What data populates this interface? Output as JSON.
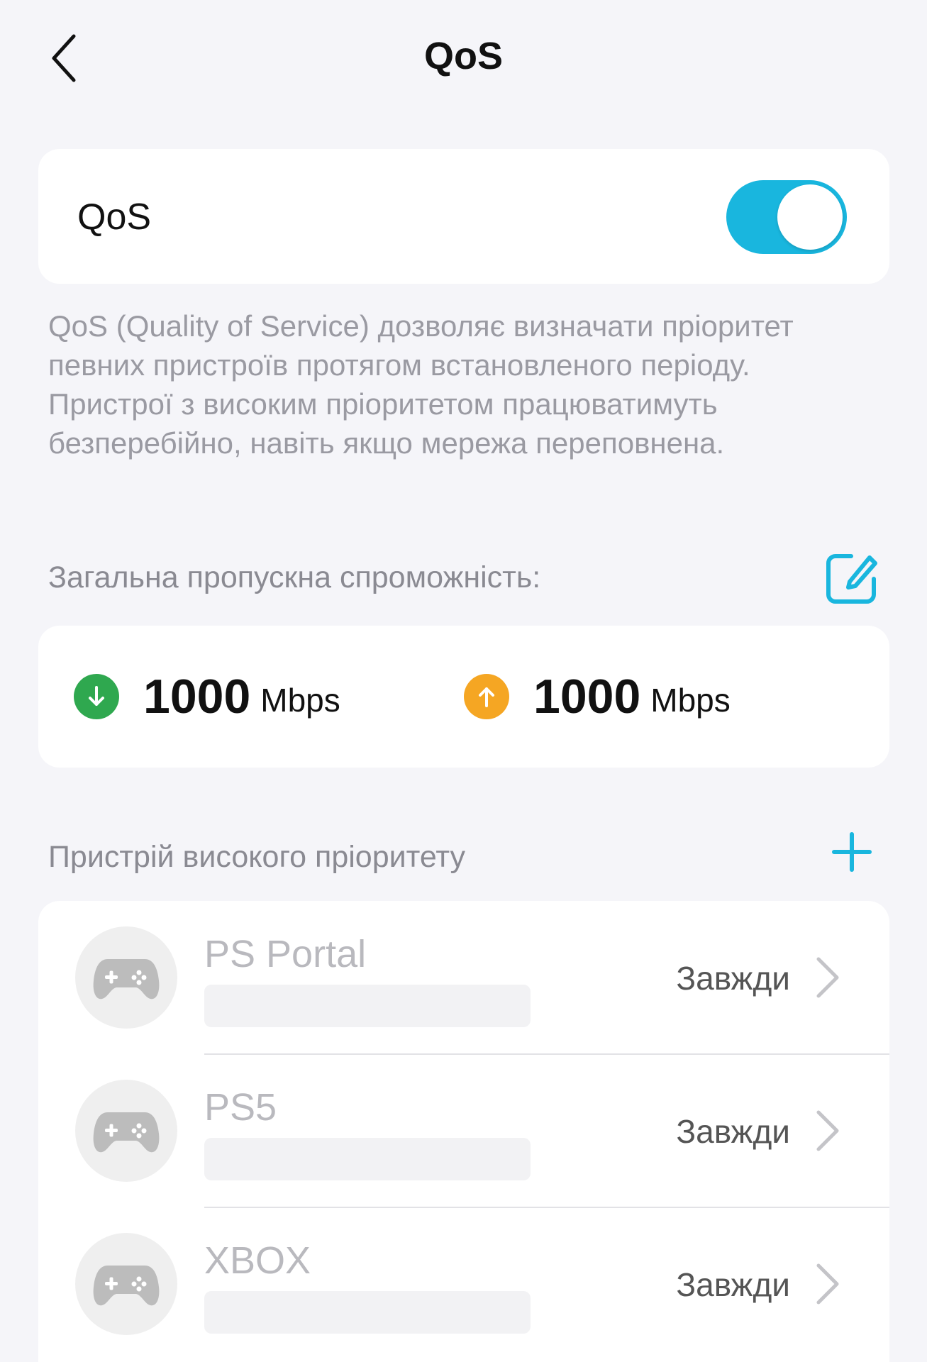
{
  "nav": {
    "title": "QoS",
    "back_icon": "chevron-left-icon"
  },
  "qos_toggle": {
    "label": "QoS",
    "enabled": true,
    "accent_color": "#19b6de"
  },
  "description": "QoS (Quality of Service) дозволяє визначати пріоритет певних пристроїв протягом встановленого періоду. Пристрої з високим пріоритетом працюватимуть безперебійно, навіть якщо мережа переповнена.",
  "bandwidth": {
    "header": "Загальна пропускна спроможність:",
    "edit_icon": "edit-icon",
    "download": {
      "value": "1000",
      "unit": "Mbps",
      "icon": "arrow-down-icon",
      "color": "#2fa84f"
    },
    "upload": {
      "value": "1000",
      "unit": "Mbps",
      "icon": "arrow-up-icon",
      "color": "#f5a623"
    }
  },
  "priority": {
    "header": "Пристрій високого пріоритету",
    "add_icon": "plus-icon",
    "devices": [
      {
        "name": "PS Portal",
        "schedule": "Завжди",
        "icon": "gamepad-icon"
      },
      {
        "name": "PS5",
        "schedule": "Завжди",
        "icon": "gamepad-icon"
      },
      {
        "name": "XBOX",
        "schedule": "Завжди",
        "icon": "gamepad-icon"
      }
    ]
  }
}
